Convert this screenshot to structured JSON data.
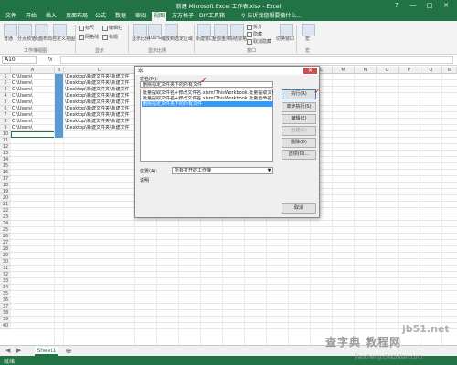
{
  "window": {
    "title": "新建 Microsoft Excel 工作表.xlsx - Excel",
    "controls": [
      "?",
      "—",
      "□",
      "✕"
    ]
  },
  "tabs": [
    "文件",
    "开始",
    "插入",
    "页面布局",
    "公式",
    "数据",
    "审阅",
    "视图",
    "方方格子",
    "DIY工具箱"
  ],
  "tell_me": "告诉我您想要做什么...",
  "ribbon": {
    "buttons": [
      "普通",
      "分页预览",
      "页面布局",
      "自定义视图",
      "显示比例",
      "100%",
      "缩放到选定区域",
      "新建窗口",
      "全部重排",
      "冻结窗格",
      "切换窗口",
      "宏"
    ],
    "checkboxes": [
      "标尺",
      "编辑栏",
      "网格线",
      "标题"
    ],
    "window_checks": [
      "拆分",
      "隐藏",
      "取消隐藏"
    ],
    "groups": [
      "工作簿视图",
      "显示",
      "显示比例",
      "窗口",
      "宏"
    ]
  },
  "formula_bar": {
    "name_box": "A10",
    "fx": "fx",
    "value": ""
  },
  "columns": [
    "A",
    "B",
    "C",
    "D",
    "E",
    "F",
    "G",
    "H",
    "I",
    "J",
    "K",
    "L",
    "M",
    "N",
    "O",
    "P",
    "Q",
    "R",
    "S",
    "T"
  ],
  "rows": [
    "1",
    "2",
    "3",
    "4",
    "5",
    "6",
    "7",
    "8",
    "9",
    "10",
    "11",
    "12",
    "13",
    "14",
    "15",
    "16",
    "17",
    "18",
    "19",
    "20",
    "21",
    "22",
    "23",
    "24",
    "25",
    "26",
    "27",
    "28",
    "29",
    "30",
    "31",
    "32",
    "33",
    "34",
    "35",
    "36",
    "37",
    "38",
    "39",
    "40"
  ],
  "cells": {
    "col_a": "C:\\Users\\",
    "col_c": "\\Desktop\\新建文件夹\\新建文件"
  },
  "dialog": {
    "title": "宏",
    "close": "✕",
    "name_label": "宏名(M):",
    "name_value": "删除指定文件夹下的所有文件",
    "macros": [
      "批量提取文件名+修改文件名.xlsm!ThisWorkbook.批量提取文件名",
      "批量提取文件名+修改文件名.xlsm!ThisWorkbook.批量重命名",
      "删除指定文件夹下的所有文件"
    ],
    "selected_index": 2,
    "location_label": "位置(A):",
    "location_value": "所有打开的工作簿",
    "description_label": "说明",
    "buttons": [
      "执行(R)",
      "单步执行(S)",
      "编辑(E)",
      "创建(C)",
      "删除(D)",
      "选项(O)..."
    ],
    "disabled": [
      false,
      false,
      false,
      true,
      false,
      false
    ],
    "cancel": "取消"
  },
  "sheet_tab": "Sheet1",
  "add_sheet": "⊕",
  "status": "就绪",
  "watermark": {
    "top": "jb51.net",
    "middle": "查字典 教程网",
    "bottom": "jiaocheng.chazidian.com"
  }
}
